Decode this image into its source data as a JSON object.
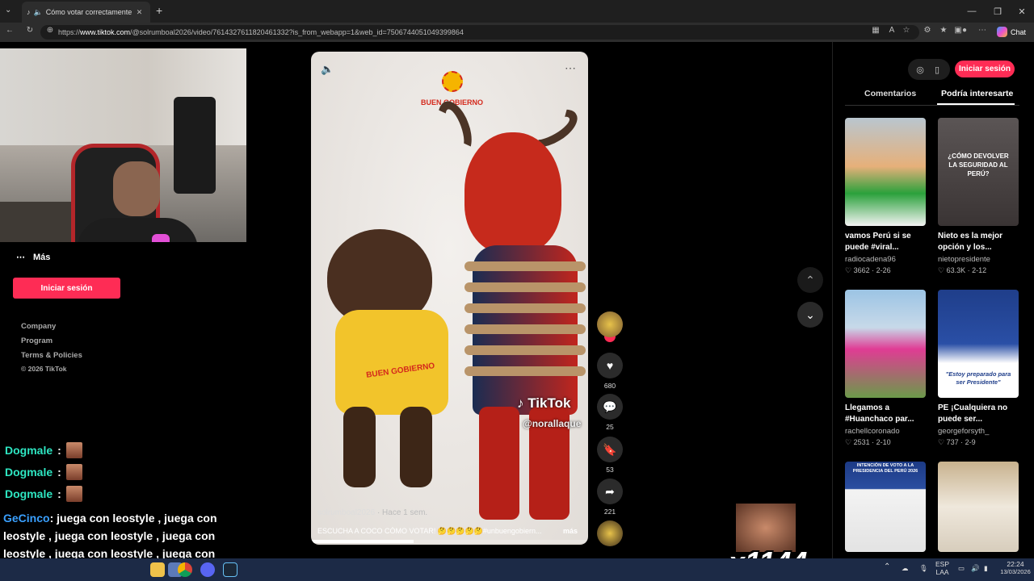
{
  "browser": {
    "tab_title": "Cómo votar correctamente en",
    "url_prefix": "https://",
    "url_host": "www.tiktok.com",
    "url_path": "/@solrumboal2026/video/7614327611820461332?is_from_webapp=1&web_id=7506744051049399864",
    "chat_label": "Chat"
  },
  "left": {
    "more_label": "Más",
    "login_label": "Iniciar sesión",
    "footer_links": [
      "Company",
      "Program",
      "Terms & Policies"
    ],
    "copyright": "© 2026 TikTok"
  },
  "chat": {
    "lines": [
      {
        "user": "Dogmale",
        "color": "#2ee6c2"
      },
      {
        "user": "Dogmale",
        "color": "#2ee6c2"
      },
      {
        "user": "Dogmale",
        "color": "#2ee6c2"
      }
    ],
    "msg_user": "GeCinco",
    "msg_user_color": "#3aa0ff",
    "msg_text": ": juega con leostyle , juega con leostyle , juega con leostyle , juega con leostyle , juega con leostyle , juega con leostyle , juega con leostyle ,"
  },
  "video": {
    "logo_text": "BUEN GOBIERNO",
    "shirt_text": "BUEN GOBIERNO",
    "watermark": "TikTok",
    "watermark_user": "@norallaque",
    "author": "solrumboal2026",
    "posted": "· Hace 1 sem.",
    "caption": "ESCUCHA A COCO CÓMO VOTAR! 🤔🤔🤔🤔🤔#unbuengobiern...",
    "more": "más",
    "progress": 0.37
  },
  "actions": {
    "likes": "680",
    "comments": "25",
    "saves": "53",
    "shares": "221"
  },
  "right": {
    "login_label": "Iniciar sesión",
    "tab_comments": "Comentarios",
    "tab_interesting": "Podría interesarte",
    "cards": [
      {
        "title": "vamos Perú si se puede #viral...",
        "user": "radiocadena96",
        "likes": "3662",
        "date": "2-26",
        "overlay": ""
      },
      {
        "title": "Nieto es la mejor opción y los...",
        "user": "nietopresidente",
        "likes": "63.3K",
        "date": "2-12",
        "overlay": "¿CÓMO DEVOLVER LA SEGURIDAD AL PERÚ?"
      },
      {
        "title": "Llegamos a #Huanchaco par...",
        "user": "rachellcoronado",
        "likes": "2531",
        "date": "2-10",
        "overlay": ""
      },
      {
        "title": "PE ¡Cualquiera no puede ser...",
        "user": "georgeforsyth_",
        "likes": "737",
        "date": "2-9",
        "overlay": "\"Estoy preparado para ser Presidente\""
      },
      {
        "title": "",
        "user": "",
        "likes": "",
        "date": "",
        "overlay": "INTENCIÓN DE VOTO A LA PRESIDENCIA DEL PERÚ 2026"
      },
      {
        "title": "",
        "user": "",
        "likes": "",
        "date": "",
        "overlay": ""
      }
    ]
  },
  "overlay": {
    "counter": "x1144"
  },
  "taskbar": {
    "lang": "ESP",
    "lang2": "LAA",
    "time": "22:24",
    "date": "13/03/2026"
  }
}
